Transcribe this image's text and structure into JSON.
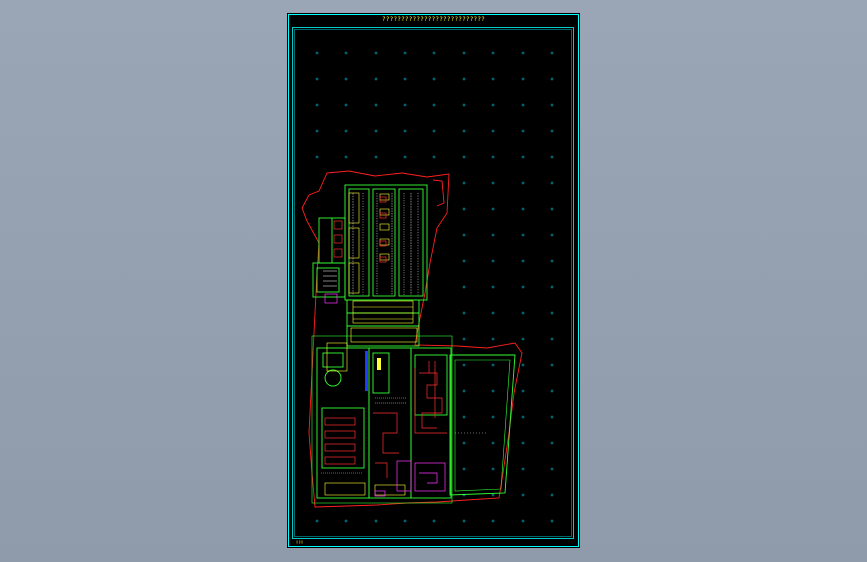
{
  "sheet": {
    "title": "???????????????????????????",
    "footer_mark": "▯▯▯"
  },
  "colors": {
    "background": "#939fae",
    "paper": "#000000",
    "frame": "#00ffff",
    "boundary": "#ff2020",
    "walls": "#33ff33",
    "text": "#ffff33",
    "equipment_red": "#ff3030",
    "equipment_magenta": "#ff33ff",
    "water": "#1e3cff",
    "grid_marks": "#00e5ff"
  },
  "layers": [
    "frame-outer",
    "frame-inner",
    "grid-crosses",
    "site-boundary",
    "building-walls",
    "equipment",
    "pool",
    "annotations"
  ]
}
